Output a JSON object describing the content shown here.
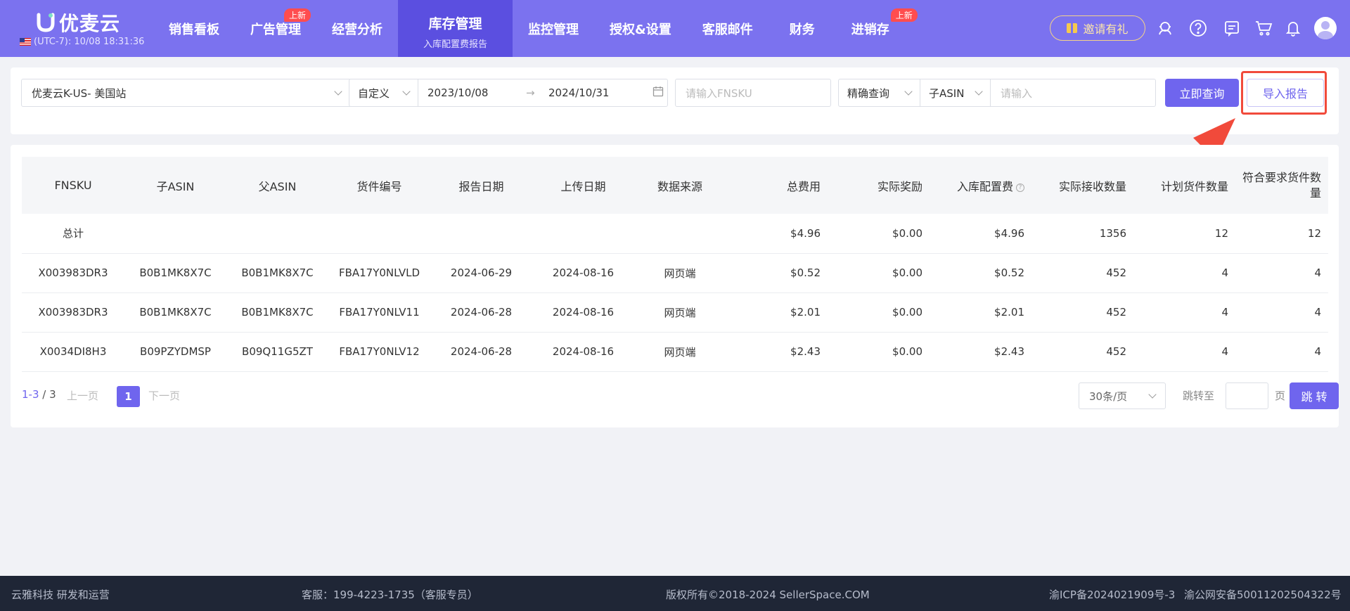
{
  "header": {
    "logo_text": "优麦云",
    "clock": "(UTC-7): 10/08 18:31:36",
    "nav": [
      {
        "label": "销售看板",
        "badge": ""
      },
      {
        "label": "广告管理",
        "badge": "上新"
      },
      {
        "label": "经营分析",
        "badge": ""
      },
      {
        "label": "库存管理",
        "badge": "",
        "sub": "入库配置费报告",
        "active": true
      },
      {
        "label": "监控管理",
        "badge": ""
      },
      {
        "label": "授权&设置",
        "badge": ""
      },
      {
        "label": "客服邮件",
        "badge": ""
      },
      {
        "label": "财务",
        "badge": ""
      },
      {
        "label": "进销存",
        "badge": "上新"
      }
    ],
    "invite_label": "邀请有礼",
    "icons": [
      "headset-icon",
      "help-icon",
      "message-icon",
      "cart-icon",
      "bell-icon",
      "avatar-icon"
    ]
  },
  "filters": {
    "shop": "优麦云K-US- 美国站",
    "date_mode": "自定义",
    "date_start": "2023/10/08",
    "date_sep": "→",
    "date_end": "2024/10/31",
    "fnsku_placeholder": "请输入FNSKU",
    "match_mode": "精确查询",
    "asin_type": "子ASIN",
    "asin_placeholder": "请输入",
    "query_button": "立即查询",
    "import_button": "导入报告"
  },
  "table": {
    "columns": [
      "FNSKU",
      "子ASIN",
      "父ASIN",
      "货件编号",
      "报告日期",
      "上传日期",
      "数据来源",
      "总费用",
      "实际奖励",
      "入库配置费",
      "实际接收数量",
      "计划货件数量",
      "符合要求货件数量"
    ],
    "total_row": {
      "label": "总计",
      "total_fee": "$4.96",
      "actual_reward": "$0.00",
      "placement_fee": "$4.96",
      "received_qty": "1356",
      "planned_qty": "12",
      "qualified_qty": "12"
    },
    "rows": [
      [
        "X003983DR3",
        "B0B1MK8X7C",
        "B0B1MK8X7C",
        "FBA17Y0NLVLD",
        "2024-06-29",
        "2024-08-16",
        "网页端",
        "$0.52",
        "$0.00",
        "$0.52",
        "452",
        "4",
        "4"
      ],
      [
        "X003983DR3",
        "B0B1MK8X7C",
        "B0B1MK8X7C",
        "FBA17Y0NLV11",
        "2024-06-28",
        "2024-08-16",
        "网页端",
        "$2.01",
        "$0.00",
        "$2.01",
        "452",
        "4",
        "4"
      ],
      [
        "X0034DI8H3",
        "B09PZYDMSP",
        "B09Q11G5ZT",
        "FBA17Y0NLV12",
        "2024-06-28",
        "2024-08-16",
        "网页端",
        "$2.43",
        "$0.00",
        "$2.43",
        "452",
        "4",
        "4"
      ]
    ]
  },
  "pagination": {
    "range": "1-3",
    "total": " / 3",
    "prev": "上一页",
    "current": "1",
    "next": "下一页",
    "page_size": "30条/页",
    "jump_label": "跳转至",
    "page_label": "页",
    "go_button": "跳 转"
  },
  "footer": {
    "company": "云雅科技 研发和运营",
    "service": "客服：199-4223-1735（客服专员）",
    "copyright": "版权所有©2018-2024 SellerSpace.COM",
    "icp": "渝ICP备2024021909号-3",
    "police": "渝公网安备50011202504322号"
  },
  "colors": {
    "header_bg": "#7b72ef",
    "nav_active_bg": "#5b4fe0",
    "primary": "#6f65ee",
    "badge": "#ff4d4f",
    "highlight_red": "#f14a3b",
    "footer_bg": "#1f2636"
  }
}
